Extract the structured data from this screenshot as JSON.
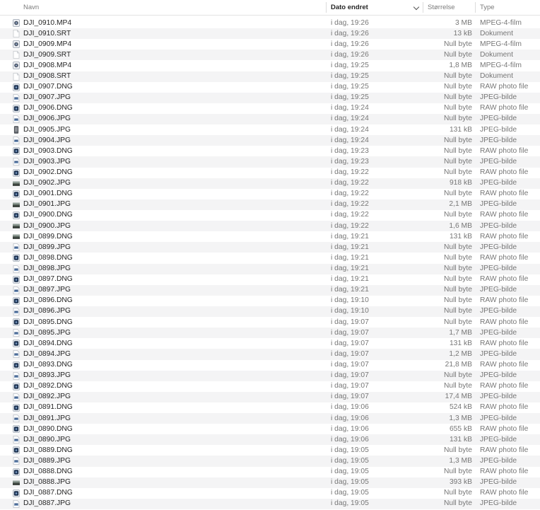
{
  "columns": {
    "name": "Navn",
    "date": "Dato endret",
    "size": "Størrelse",
    "type": "Type"
  },
  "files": [
    {
      "name": "DJI_0910.MP4",
      "date": "i dag, 19:26",
      "size": "3 MB",
      "type": "MPEG-4-film",
      "icon": "video-file-icon"
    },
    {
      "name": "DJI_0910.SRT",
      "date": "i dag, 19:26",
      "size": "13 kB",
      "type": "Dokument",
      "icon": "document-file-icon"
    },
    {
      "name": "DJI_0909.MP4",
      "date": "i dag, 19:26",
      "size": "Null byte",
      "type": "MPEG-4-film",
      "icon": "video-file-icon"
    },
    {
      "name": "DJI_0909.SRT",
      "date": "i dag, 19:26",
      "size": "Null byte",
      "type": "Dokument",
      "icon": "document-file-icon"
    },
    {
      "name": "DJI_0908.MP4",
      "date": "i dag, 19:25",
      "size": "1,8 MB",
      "type": "MPEG-4-film",
      "icon": "video-file-icon"
    },
    {
      "name": "DJI_0908.SRT",
      "date": "i dag, 19:25",
      "size": "Null byte",
      "type": "Dokument",
      "icon": "document-file-icon"
    },
    {
      "name": "DJI_0907.DNG",
      "date": "i dag, 19:25",
      "size": "Null byte",
      "type": "RAW photo file",
      "icon": "raw-file-icon"
    },
    {
      "name": "DJI_0907.JPG",
      "date": "i dag, 19:25",
      "size": "Null byte",
      "type": "JPEG-bilde",
      "icon": "image-file-icon"
    },
    {
      "name": "DJI_0906.DNG",
      "date": "i dag, 19:24",
      "size": "Null byte",
      "type": "RAW photo file",
      "icon": "raw-file-icon"
    },
    {
      "name": "DJI_0906.JPG",
      "date": "i dag, 19:24",
      "size": "Null byte",
      "type": "JPEG-bilde",
      "icon": "image-file-icon"
    },
    {
      "name": "DJI_0905.JPG",
      "date": "i dag, 19:24",
      "size": "131 kB",
      "type": "JPEG-bilde",
      "icon": "portrait-thumbnail-icon"
    },
    {
      "name": "DJI_0904.JPG",
      "date": "i dag, 19:24",
      "size": "Null byte",
      "type": "JPEG-bilde",
      "icon": "image-file-icon"
    },
    {
      "name": "DJI_0903.DNG",
      "date": "i dag, 19:23",
      "size": "Null byte",
      "type": "RAW photo file",
      "icon": "raw-file-icon"
    },
    {
      "name": "DJI_0903.JPG",
      "date": "i dag, 19:23",
      "size": "Null byte",
      "type": "JPEG-bilde",
      "icon": "image-file-icon"
    },
    {
      "name": "DJI_0902.DNG",
      "date": "i dag, 19:22",
      "size": "Null byte",
      "type": "RAW photo file",
      "icon": "raw-file-icon"
    },
    {
      "name": "DJI_0902.JPG",
      "date": "i dag, 19:22",
      "size": "918 kB",
      "type": "JPEG-bilde",
      "icon": "landscape-thumbnail-icon"
    },
    {
      "name": "DJI_0901.DNG",
      "date": "i dag, 19:22",
      "size": "Null byte",
      "type": "RAW photo file",
      "icon": "raw-file-icon"
    },
    {
      "name": "DJI_0901.JPG",
      "date": "i dag, 19:22",
      "size": "2,1 MB",
      "type": "JPEG-bilde",
      "icon": "landscape-thumbnail-icon"
    },
    {
      "name": "DJI_0900.DNG",
      "date": "i dag, 19:22",
      "size": "Null byte",
      "type": "RAW photo file",
      "icon": "raw-file-icon"
    },
    {
      "name": "DJI_0900.JPG",
      "date": "i dag, 19:22",
      "size": "1,6 MB",
      "type": "JPEG-bilde",
      "icon": "landscape-thumbnail-icon"
    },
    {
      "name": "DJI_0899.DNG",
      "date": "i dag, 19:21",
      "size": "131 kB",
      "type": "RAW photo file",
      "icon": "landscape-thumbnail-icon"
    },
    {
      "name": "DJI_0899.JPG",
      "date": "i dag, 19:21",
      "size": "Null byte",
      "type": "JPEG-bilde",
      "icon": "image-file-icon"
    },
    {
      "name": "DJI_0898.DNG",
      "date": "i dag, 19:21",
      "size": "Null byte",
      "type": "RAW photo file",
      "icon": "raw-file-icon"
    },
    {
      "name": "DJI_0898.JPG",
      "date": "i dag, 19:21",
      "size": "Null byte",
      "type": "JPEG-bilde",
      "icon": "image-file-icon"
    },
    {
      "name": "DJI_0897.DNG",
      "date": "i dag, 19:21",
      "size": "Null byte",
      "type": "RAW photo file",
      "icon": "raw-file-icon"
    },
    {
      "name": "DJI_0897.JPG",
      "date": "i dag, 19:21",
      "size": "Null byte",
      "type": "JPEG-bilde",
      "icon": "image-file-icon"
    },
    {
      "name": "DJI_0896.DNG",
      "date": "i dag, 19:10",
      "size": "Null byte",
      "type": "RAW photo file",
      "icon": "raw-file-icon"
    },
    {
      "name": "DJI_0896.JPG",
      "date": "i dag, 19:10",
      "size": "Null byte",
      "type": "JPEG-bilde",
      "icon": "image-file-icon"
    },
    {
      "name": "DJI_0895.DNG",
      "date": "i dag, 19:07",
      "size": "Null byte",
      "type": "RAW photo file",
      "icon": "raw-file-icon"
    },
    {
      "name": "DJI_0895.JPG",
      "date": "i dag, 19:07",
      "size": "1,7 MB",
      "type": "JPEG-bilde",
      "icon": "image-file-icon"
    },
    {
      "name": "DJI_0894.DNG",
      "date": "i dag, 19:07",
      "size": "131 kB",
      "type": "RAW photo file",
      "icon": "raw-file-icon"
    },
    {
      "name": "DJI_0894.JPG",
      "date": "i dag, 19:07",
      "size": "1,2 MB",
      "type": "JPEG-bilde",
      "icon": "image-file-icon"
    },
    {
      "name": "DJI_0893.DNG",
      "date": "i dag, 19:07",
      "size": "21,8 MB",
      "type": "RAW photo file",
      "icon": "raw-file-icon"
    },
    {
      "name": "DJI_0893.JPG",
      "date": "i dag, 19:07",
      "size": "Null byte",
      "type": "JPEG-bilde",
      "icon": "image-file-icon"
    },
    {
      "name": "DJI_0892.DNG",
      "date": "i dag, 19:07",
      "size": "Null byte",
      "type": "RAW photo file",
      "icon": "raw-file-icon"
    },
    {
      "name": "DJI_0892.JPG",
      "date": "i dag, 19:07",
      "size": "17,4 MB",
      "type": "JPEG-bilde",
      "icon": "image-file-icon"
    },
    {
      "name": "DJI_0891.DNG",
      "date": "i dag, 19:06",
      "size": "524 kB",
      "type": "RAW photo file",
      "icon": "raw-file-icon"
    },
    {
      "name": "DJI_0891.JPG",
      "date": "i dag, 19:06",
      "size": "1,3 MB",
      "type": "JPEG-bilde",
      "icon": "image-file-icon"
    },
    {
      "name": "DJI_0890.DNG",
      "date": "i dag, 19:06",
      "size": "655 kB",
      "type": "RAW photo file",
      "icon": "raw-file-icon"
    },
    {
      "name": "DJI_0890.JPG",
      "date": "i dag, 19:06",
      "size": "131 kB",
      "type": "JPEG-bilde",
      "icon": "image-file-icon"
    },
    {
      "name": "DJI_0889.DNG",
      "date": "i dag, 19:05",
      "size": "Null byte",
      "type": "RAW photo file",
      "icon": "raw-file-icon"
    },
    {
      "name": "DJI_0889.JPG",
      "date": "i dag, 19:05",
      "size": "1,3 MB",
      "type": "JPEG-bilde",
      "icon": "image-file-icon"
    },
    {
      "name": "DJI_0888.DNG",
      "date": "i dag, 19:05",
      "size": "Null byte",
      "type": "RAW photo file",
      "icon": "raw-file-icon"
    },
    {
      "name": "DJI_0888.JPG",
      "date": "i dag, 19:05",
      "size": "393 kB",
      "type": "JPEG-bilde",
      "icon": "landscape-thumbnail-icon"
    },
    {
      "name": "DJI_0887.DNG",
      "date": "i dag, 19:05",
      "size": "Null byte",
      "type": "RAW photo file",
      "icon": "raw-file-icon"
    },
    {
      "name": "DJI_0887.JPG",
      "date": "i dag, 19:05",
      "size": "Null byte",
      "type": "JPEG-bilde",
      "icon": "image-file-icon"
    }
  ]
}
